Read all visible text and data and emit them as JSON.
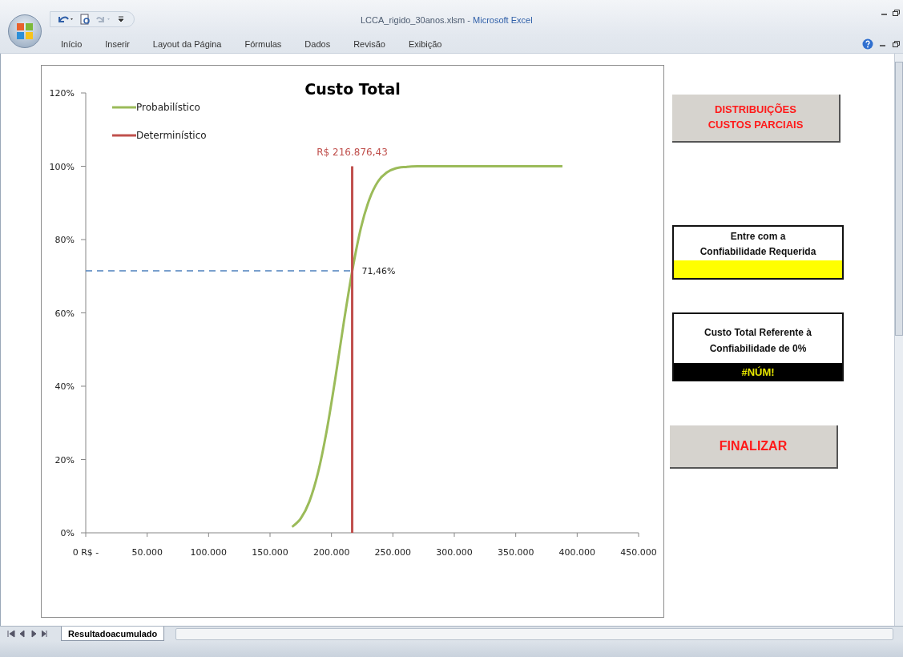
{
  "window": {
    "title": "LCCA_rigido_30anos.xlsm",
    "separator": "-",
    "app": "Microsoft Excel"
  },
  "ribbon_tabs": [
    {
      "label": "Início"
    },
    {
      "label": "Inserir"
    },
    {
      "label": "Layout da Página"
    },
    {
      "label": "Fórmulas"
    },
    {
      "label": "Dados"
    },
    {
      "label": "Revisão"
    },
    {
      "label": "Exibição"
    }
  ],
  "chart": {
    "chart_data": {
      "type": "line",
      "title": "Custo Total",
      "xlim": [
        0,
        450000
      ],
      "ylim": [
        0,
        1.2
      ],
      "xticks": [
        {
          "value": 0,
          "label": "0 R$ -"
        },
        {
          "value": 50000,
          "label": "50.000"
        },
        {
          "value": 100000,
          "label": "100.000"
        },
        {
          "value": 150000,
          "label": "150.000"
        },
        {
          "value": 200000,
          "label": "200.000"
        },
        {
          "value": 250000,
          "label": "250.000"
        },
        {
          "value": 300000,
          "label": "300.000"
        },
        {
          "value": 350000,
          "label": "350.000"
        },
        {
          "value": 400000,
          "label": "400.000"
        },
        {
          "value": 450000,
          "label": "450.000"
        }
      ],
      "yticks": [
        {
          "value": 0,
          "label": "0%"
        },
        {
          "value": 0.2,
          "label": "20%"
        },
        {
          "value": 0.4,
          "label": "40%"
        },
        {
          "value": 0.6,
          "label": "60%"
        },
        {
          "value": 0.8,
          "label": "80%"
        },
        {
          "value": 1.0,
          "label": "100%"
        },
        {
          "value": 1.2,
          "label": "120%"
        }
      ],
      "series": [
        {
          "name": "Probabilístico",
          "color": "#9bbb59",
          "x": [
            168000,
            175000,
            182000,
            189000,
            196000,
            203000,
            210000,
            217000,
            224000,
            231000,
            238000,
            245000,
            252000,
            260000,
            270000,
            300000,
            350000,
            388000
          ],
          "values": [
            0.016,
            0.039,
            0.085,
            0.163,
            0.276,
            0.418,
            0.573,
            0.716,
            0.832,
            0.911,
            0.959,
            0.983,
            0.994,
            0.998,
            1.0,
            1.0,
            1.0,
            1.0
          ]
        },
        {
          "name": "Determinístico",
          "color": "#c0504d",
          "x": [
            216876.43,
            216876.43
          ],
          "values": [
            0,
            1.0
          ]
        }
      ],
      "legend": true,
      "ref_lines": [
        {
          "axis": "y",
          "value": 0.7146,
          "label": "71,46%"
        }
      ],
      "annotations": [
        "R$ 216.876,43"
      ]
    }
  },
  "panel": {
    "distributions_button": "DISTRIBUIÇÕES\nCUSTOS PARCIAIS",
    "reliability_input": {
      "label": "Entre com a\nConfiabilidade Requerida"
    },
    "result": {
      "label": "Custo Total Referente à\nConfiabilidade de 0%",
      "value": "#NÚM!"
    },
    "finish_button": "FINALIZAR"
  },
  "sheet_tabs": [
    {
      "label": "Resultadoacumulado",
      "selected": true
    }
  ]
}
